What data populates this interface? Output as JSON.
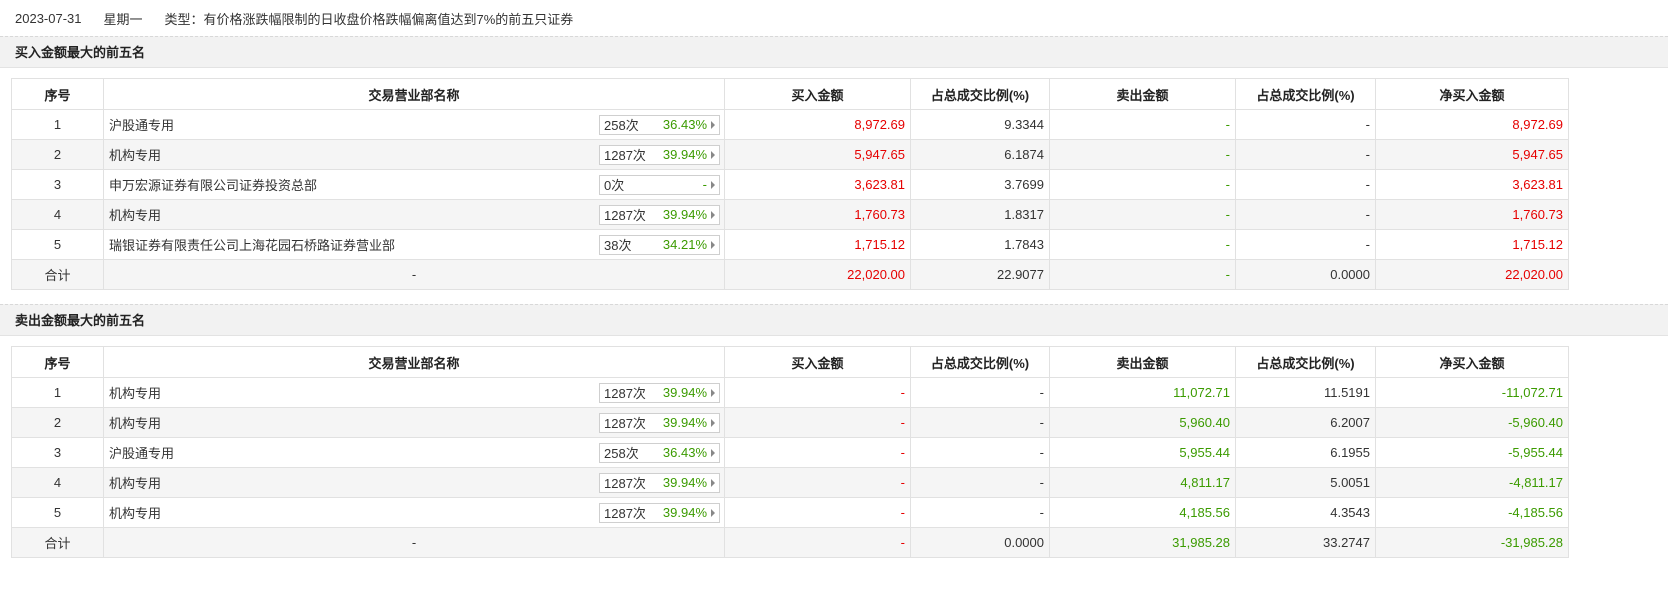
{
  "header": {
    "date": "2023-07-31",
    "weekday": "星期一",
    "type_label": "类型：有价格涨跌幅限制的日收盘价格跌幅偏离值达到7%的前五只证券"
  },
  "columns": [
    "序号",
    "交易营业部名称",
    "买入金额",
    "占总成交比例(%)",
    "卖出金额",
    "占总成交比例(%)",
    "净买入金额"
  ],
  "buy_section": {
    "title": "买入金额最大的前五名",
    "rows": [
      {
        "seq": "1",
        "name": "沪股通专用",
        "count": "258次",
        "pct": "36.43%",
        "buy": "8,972.69",
        "buy_ratio": "9.3344",
        "sell": "-",
        "sell_ratio": "-",
        "net": "8,972.69"
      },
      {
        "seq": "2",
        "name": "机构专用",
        "count": "1287次",
        "pct": "39.94%",
        "buy": "5,947.65",
        "buy_ratio": "6.1874",
        "sell": "-",
        "sell_ratio": "-",
        "net": "5,947.65"
      },
      {
        "seq": "3",
        "name": "申万宏源证券有限公司证券投资总部",
        "count": "0次",
        "pct": "-",
        "buy": "3,623.81",
        "buy_ratio": "3.7699",
        "sell": "-",
        "sell_ratio": "-",
        "net": "3,623.81"
      },
      {
        "seq": "4",
        "name": "机构专用",
        "count": "1287次",
        "pct": "39.94%",
        "buy": "1,760.73",
        "buy_ratio": "1.8317",
        "sell": "-",
        "sell_ratio": "-",
        "net": "1,760.73"
      },
      {
        "seq": "5",
        "name": "瑞银证券有限责任公司上海花园石桥路证券营业部",
        "count": "38次",
        "pct": "34.21%",
        "buy": "1,715.12",
        "buy_ratio": "1.7843",
        "sell": "-",
        "sell_ratio": "-",
        "net": "1,715.12"
      }
    ],
    "total": {
      "label": "合计",
      "name": "-",
      "buy": "22,020.00",
      "buy_ratio": "22.9077",
      "sell": "-",
      "sell_ratio": "0.0000",
      "net": "22,020.00"
    }
  },
  "sell_section": {
    "title": "卖出金额最大的前五名",
    "rows": [
      {
        "seq": "1",
        "name": "机构专用",
        "count": "1287次",
        "pct": "39.94%",
        "buy": "-",
        "buy_ratio": "-",
        "sell": "11,072.71",
        "sell_ratio": "11.5191",
        "net": "-11,072.71"
      },
      {
        "seq": "2",
        "name": "机构专用",
        "count": "1287次",
        "pct": "39.94%",
        "buy": "-",
        "buy_ratio": "-",
        "sell": "5,960.40",
        "sell_ratio": "6.2007",
        "net": "-5,960.40"
      },
      {
        "seq": "3",
        "name": "沪股通专用",
        "count": "258次",
        "pct": "36.43%",
        "buy": "-",
        "buy_ratio": "-",
        "sell": "5,955.44",
        "sell_ratio": "6.1955",
        "net": "-5,955.44"
      },
      {
        "seq": "4",
        "name": "机构专用",
        "count": "1287次",
        "pct": "39.94%",
        "buy": "-",
        "buy_ratio": "-",
        "sell": "4,811.17",
        "sell_ratio": "5.0051",
        "net": "-4,811.17"
      },
      {
        "seq": "5",
        "name": "机构专用",
        "count": "1287次",
        "pct": "39.94%",
        "buy": "-",
        "buy_ratio": "-",
        "sell": "4,185.56",
        "sell_ratio": "4.3543",
        "net": "-4,185.56"
      }
    ],
    "total": {
      "label": "合计",
      "name": "-",
      "buy": "-",
      "buy_ratio": "0.0000",
      "sell": "31,985.28",
      "sell_ratio": "33.2747",
      "net": "-31,985.28"
    }
  },
  "colors": {
    "up": "#e60000",
    "down": "#3b9b00"
  }
}
